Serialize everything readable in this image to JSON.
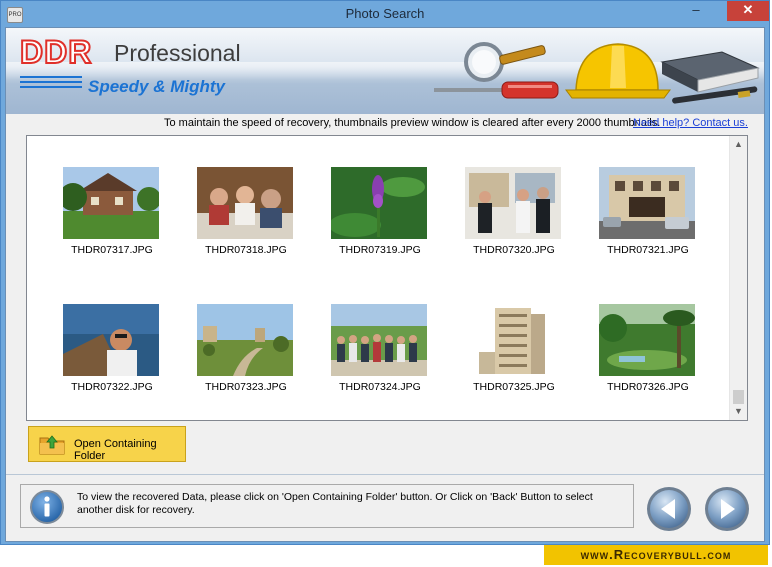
{
  "window": {
    "title": "Photo Search",
    "icon_label": "PRO",
    "minimize": "–",
    "maximize": "□",
    "close": "✕"
  },
  "banner": {
    "brand": "DDR",
    "edition": "Professional",
    "tagline": "Speedy & Mighty",
    "decor_icons": [
      "magnifier-icon",
      "screwdriver-icon",
      "hardhat-icon",
      "book-icon",
      "pen-icon"
    ]
  },
  "info": {
    "message": "To maintain the speed of recovery, thumbnails preview window is cleared after every 2000 thumbnails.",
    "help_link": "Need help? Contact us."
  },
  "thumbnails": [
    {
      "filename": "THDR07317.JPG",
      "scene": "house-garden"
    },
    {
      "filename": "THDR07318.JPG",
      "scene": "people-dining"
    },
    {
      "filename": "THDR07319.JPG",
      "scene": "purple-flower"
    },
    {
      "filename": "THDR07320.JPG",
      "scene": "people-booth"
    },
    {
      "filename": "THDR07321.JPG",
      "scene": "street-building"
    },
    {
      "filename": "THDR07322.JPG",
      "scene": "man-seaside"
    },
    {
      "filename": "THDR07323.JPG",
      "scene": "park-path"
    },
    {
      "filename": "THDR07324.JPG",
      "scene": "group-outdoors"
    },
    {
      "filename": "THDR07325.JPG",
      "scene": "apartment-tower"
    },
    {
      "filename": "THDR07326.JPG",
      "scene": "tropical-garden"
    }
  ],
  "actions": {
    "open_folder": "Open Containing Folder"
  },
  "status": {
    "instruction": "To view the recovered Data, please click on 'Open Containing Folder' button. Or Click on 'Back' Button to select another disk for recovery."
  },
  "footer": {
    "site": "www.Recoverybull.com"
  },
  "colors": {
    "title_bar": "#6fa8dc",
    "folder_button": "#f7d34a",
    "brand_red": "#e0302a",
    "tagline_blue": "#1b73d3",
    "footer_yellow": "#f2c300",
    "link_blue": "#1a3fd6"
  }
}
